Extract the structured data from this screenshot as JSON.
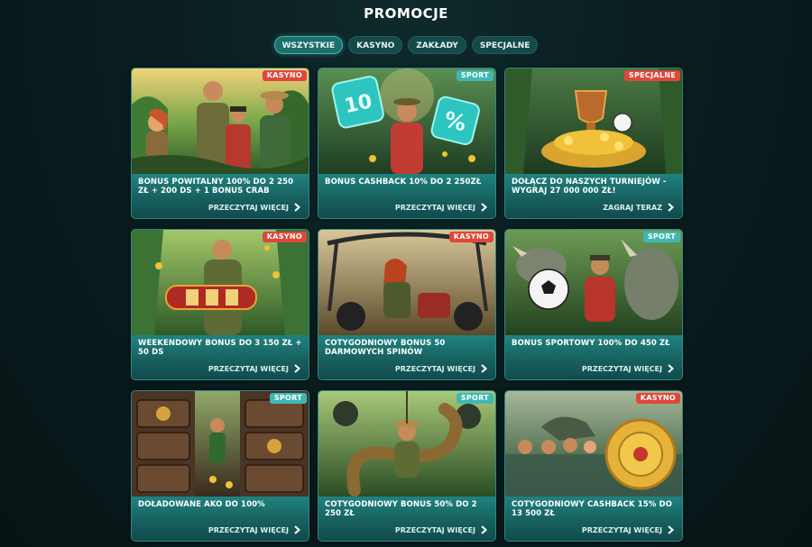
{
  "page": {
    "title": "PROMOCJE"
  },
  "tabs": [
    {
      "label": "WSZYSTKIE",
      "active": true
    },
    {
      "label": "KASYNO",
      "active": false
    },
    {
      "label": "ZAKŁADY",
      "active": false
    },
    {
      "label": "SPECJALNE",
      "active": false
    }
  ],
  "colors": {
    "badge_kasyno": "#e0473b",
    "badge_sport": "#3fb8b4",
    "card_footer": "#17605f",
    "active_tab": "#1d6e6c"
  },
  "promotions": [
    {
      "badge": "KASYNO",
      "badge_type": "kasyno",
      "title": "BONUS POWITALNY 100% DO 2 250 ZŁ + 200 DS + 1 BONUS CRAB",
      "link": "PRZECZYTAJ WIĘCEJ",
      "scene": "explorers"
    },
    {
      "badge": "SPORT",
      "badge_type": "sport",
      "title": "BONUS CASHBACK 10% DO 2 250ZŁ",
      "link": "PRZECZYTAJ WIĘCEJ",
      "scene": "dice"
    },
    {
      "badge": "SPECJALNE",
      "badge_type": "specjalne",
      "title": "DOŁĄCZ DO NASZYCH TURNIEJÓW - WYGRAJ 27 000 000 ZŁ!",
      "link": "ZAGRAJ TERAZ",
      "scene": "trophy"
    },
    {
      "badge": "KASYNO",
      "badge_type": "kasyno",
      "title": "WEEKENDOWY BONUS DO 3 150 ZŁ + 50 DS",
      "link": "PRZECZYTAJ WIĘCEJ",
      "scene": "slot"
    },
    {
      "badge": "KASYNO",
      "badge_type": "kasyno",
      "title": "COTYGODNIOWY BONUS 50 DARMOWYCH SPINÓW",
      "link": "PRZECZYTAJ WIĘCEJ",
      "scene": "buggy"
    },
    {
      "badge": "SPORT",
      "badge_type": "sport",
      "title": "BONUS SPORTOWY 100% DO 450 ZŁ",
      "link": "PRZECZYTAJ WIĘCEJ",
      "scene": "rhino"
    },
    {
      "badge": "SPORT",
      "badge_type": "sport",
      "title": "DOŁADOWANE AKO DO 100%",
      "link": "PRZECZYTAJ WIĘCEJ",
      "scene": "temple"
    },
    {
      "badge": "SPORT",
      "badge_type": "sport",
      "title": "COTYGODNIOWY BONUS 50% DO 2 250 ZŁ",
      "link": "PRZECZYTAJ WIĘCEJ",
      "scene": "snake"
    },
    {
      "badge": "KASYNO",
      "badge_type": "kasyno",
      "title": "COTYGODNIOWY CASHBACK 15% DO 13 500 ZŁ",
      "link": "PRZECZYTAJ WIĘCEJ",
      "scene": "swamp"
    }
  ]
}
